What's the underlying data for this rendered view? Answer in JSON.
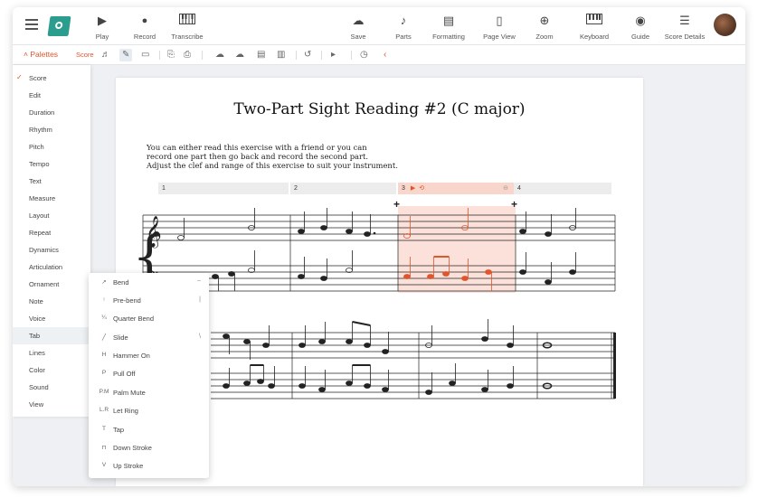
{
  "toolbar": {
    "left_tools": [
      {
        "label": "Play",
        "icon": "play-icon"
      },
      {
        "label": "Record",
        "icon": "record-icon"
      },
      {
        "label": "Transcribe",
        "icon": "piano-icon"
      }
    ],
    "right_tools": [
      {
        "label": "Save",
        "icon": "cloud-upload-icon"
      },
      {
        "label": "Parts",
        "icon": "guitar-icon"
      },
      {
        "label": "Formatting",
        "icon": "formatting-icon"
      },
      {
        "label": "Page View",
        "icon": "page-view-icon"
      },
      {
        "label": "Zoom",
        "icon": "zoom-icon"
      },
      {
        "label": "Keyboard",
        "icon": "keyboard-icon"
      },
      {
        "label": "Guide",
        "icon": "compass-icon"
      },
      {
        "label": "Score Details",
        "icon": "details-icon"
      }
    ]
  },
  "subtoolbar": {
    "palettes_label": "Palettes",
    "score_label": "Score"
  },
  "palette": {
    "items": [
      "Score",
      "Edit",
      "Duration",
      "Rhythm",
      "Pitch",
      "Tempo",
      "Text",
      "Measure",
      "Layout",
      "Repeat",
      "Dynamics",
      "Articulation",
      "Ornament",
      "Note",
      "Voice",
      "Tab",
      "Lines",
      "Color",
      "Sound",
      "View"
    ],
    "checked": "Score",
    "highlighted": "Tab"
  },
  "tab_popup": {
    "items": [
      {
        "label": "Bend",
        "icon_text": "↗",
        "shortcut": "~"
      },
      {
        "label": "Pre-bend",
        "icon_text": "↑",
        "shortcut": "|"
      },
      {
        "label": "Quarter Bend",
        "icon_text": "¼",
        "shortcut": ""
      },
      {
        "label": "Slide",
        "icon_text": "╱",
        "shortcut": "\\"
      },
      {
        "label": "Hammer On",
        "icon_text": "H",
        "shortcut": ""
      },
      {
        "label": "Pull Off",
        "icon_text": "P",
        "shortcut": ""
      },
      {
        "label": "Palm Mute",
        "icon_text": "P.M",
        "shortcut": ""
      },
      {
        "label": "Let Ring",
        "icon_text": "L.R",
        "shortcut": ""
      },
      {
        "label": "Tap",
        "icon_text": "T",
        "shortcut": ""
      },
      {
        "label": "Down Stroke",
        "icon_text": "⊓",
        "shortcut": ""
      },
      {
        "label": "Up Stroke",
        "icon_text": "V",
        "shortcut": ""
      }
    ]
  },
  "score": {
    "title": "Two-Part Sight Reading #2 (C major)",
    "instructions": [
      "You can either read this exercise with a friend or you can",
      "record one part then go back and record the second part.",
      "Adjust the clef and range of this exercise to suit your instrument."
    ],
    "measure_numbers": [
      "1",
      "2",
      "3",
      "4"
    ],
    "loop_color": "#e0552b"
  }
}
